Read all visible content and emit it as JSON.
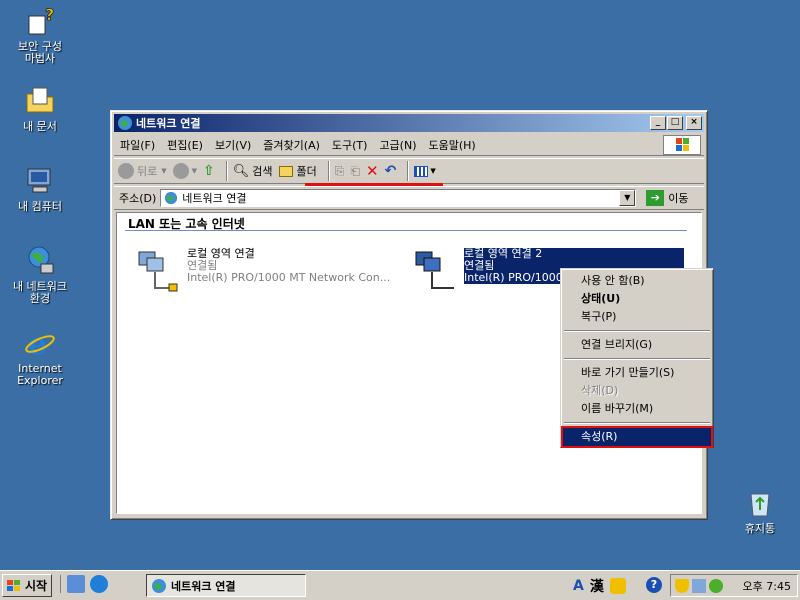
{
  "desktop": {
    "icons": [
      {
        "label": "보안 구성\n마법사",
        "icon": "security-wizard-icon"
      },
      {
        "label": "내 문서",
        "icon": "my-documents-icon"
      },
      {
        "label": "내 컴퓨터",
        "icon": "my-computer-icon"
      },
      {
        "label": "내 네트워크\n환경",
        "icon": "my-network-icon"
      },
      {
        "label": "Internet\nExplorer",
        "icon": "internet-explorer-icon"
      },
      {
        "label": "휴지통",
        "icon": "recycle-bin-icon"
      }
    ]
  },
  "window": {
    "title": "네트워크 연결",
    "controls": {
      "minimize": "_",
      "maximize": "□",
      "close": "×"
    },
    "menu": [
      "파일(F)",
      "편집(E)",
      "보기(V)",
      "즐겨찾기(A)",
      "도구(T)",
      "고급(N)",
      "도움말(H)"
    ],
    "toolbar": {
      "back": "뒤로",
      "forward": "",
      "search": "검색",
      "folders": "폴더"
    },
    "address": {
      "label": "주소(D)",
      "value": "네트워크 연결",
      "go": "이동"
    },
    "group_header": "LAN 또는 고속 인터넷",
    "connections": [
      {
        "name": "로컬 영역 연결",
        "status": "연결됨",
        "adapter": "Intel(R) PRO/1000 MT Network Con..."
      },
      {
        "name": "로컬 영역 연결 2",
        "status": "연결됨",
        "adapter": "Intel(R) PRO/1000"
      }
    ]
  },
  "context_menu": {
    "items": [
      {
        "label": "사용 안 함(B)",
        "style": "normal"
      },
      {
        "label": "상태(U)",
        "style": "bold"
      },
      {
        "label": "복구(P)",
        "style": "normal"
      },
      {
        "sep": true
      },
      {
        "label": "연결 브리지(G)",
        "style": "normal"
      },
      {
        "sep": true
      },
      {
        "label": "바로 가기 만들기(S)",
        "style": "normal"
      },
      {
        "label": "삭제(D)",
        "style": "disabled"
      },
      {
        "label": "이름 바꾸기(M)",
        "style": "normal"
      },
      {
        "sep": true
      },
      {
        "label": "속성(R)",
        "style": "highlighted"
      }
    ]
  },
  "taskbar": {
    "start_label": "시작",
    "task_title": "네트워크 연결",
    "ime_a": "A",
    "ime_han": "漢",
    "help": "?",
    "clock": "오후 7:45"
  },
  "colors": {
    "desktop": "#3a6ea5",
    "title_start": "#0a246a",
    "title_end": "#a6caf0",
    "highlight": "#0a246a",
    "annotation_red": "#e01010"
  }
}
